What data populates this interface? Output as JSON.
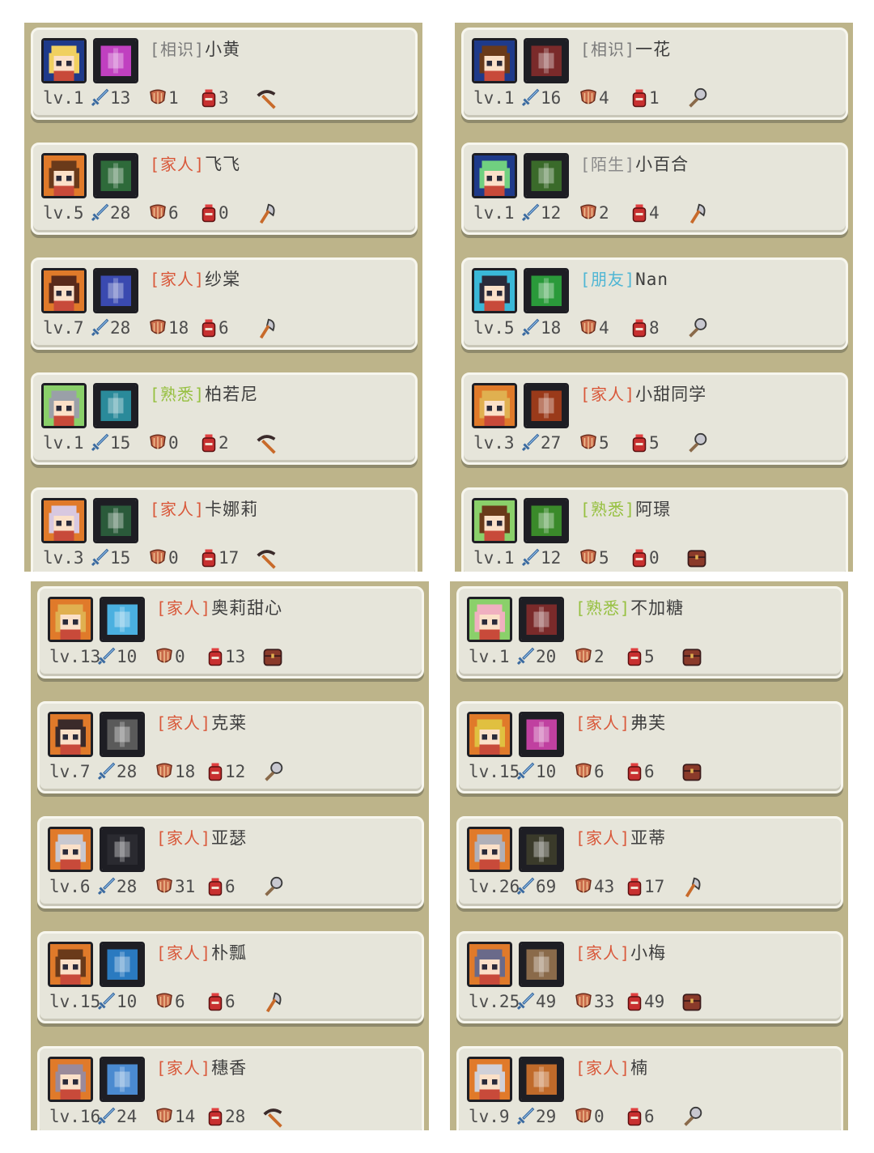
{
  "colors": {
    "panel_bg": "#bdb48a",
    "card_bg": "#e6e5da",
    "relations": {
      "相识": "#7a7a7a",
      "陌生": "#8a8a8a",
      "家人": "#d9583a",
      "熟悉": "#96c040",
      "朋友": "#4fb6d4"
    }
  },
  "panels": [
    {
      "id": "top-left",
      "characters": [
        {
          "relation": "相识",
          "name": "小黄",
          "level": "lv.1",
          "attack": "13",
          "defense": "1",
          "hp": "3",
          "tool": "pickaxe-icon",
          "portrait_bg": "#1e3a8a",
          "hair": "#f0d060",
          "skill_color": "#c040c0"
        },
        {
          "relation": "家人",
          "name": "飞飞",
          "level": "lv.5",
          "attack": "28",
          "defense": "6",
          "hp": "0",
          "tool": "axe-icon",
          "portrait_bg": "#e07a2a",
          "hair": "#6a3a1a",
          "skill_color": "#2e6a3a"
        },
        {
          "relation": "家人",
          "name": "纱棠",
          "level": "lv.7",
          "attack": "28",
          "defense": "18",
          "hp": "6",
          "tool": "axe-icon",
          "portrait_bg": "#e07a2a",
          "hair": "#5a2a1a",
          "skill_color": "#3a4ab0"
        },
        {
          "relation": "熟悉",
          "name": "柏若尼",
          "level": "lv.1",
          "attack": "15",
          "defense": "0",
          "hp": "2",
          "tool": "pickaxe-icon",
          "portrait_bg": "#8ad06a",
          "hair": "#9aa0a8",
          "skill_color": "#2a8a9a"
        },
        {
          "relation": "家人",
          "name": "卡娜莉",
          "level": "lv.3",
          "attack": "15",
          "defense": "0",
          "hp": "17",
          "tool": "pickaxe-icon",
          "portrait_bg": "#e07a2a",
          "hair": "#d8c8e0",
          "skill_color": "#2a5a3a"
        }
      ]
    },
    {
      "id": "top-right",
      "characters": [
        {
          "relation": "相识",
          "name": "一花",
          "level": "lv.1",
          "attack": "16",
          "defense": "4",
          "hp": "1",
          "tool": "shovel-icon",
          "portrait_bg": "#1e3a8a",
          "hair": "#6a3a1a",
          "skill_color": "#7a2a2a"
        },
        {
          "relation": "陌生",
          "name": "小百合",
          "level": "lv.1",
          "attack": "12",
          "defense": "2",
          "hp": "4",
          "tool": "axe-icon",
          "portrait_bg": "#1e3a8a",
          "hair": "#70d080",
          "skill_color": "#3a6a2a"
        },
        {
          "relation": "朋友",
          "name": "Nan",
          "level": "lv.5",
          "attack": "18",
          "defense": "4",
          "hp": "8",
          "tool": "shovel-icon",
          "portrait_bg": "#3ab8d8",
          "hair": "#2a2a3a",
          "skill_color": "#2a9a3a"
        },
        {
          "relation": "家人",
          "name": "小甜同学",
          "level": "lv.3",
          "attack": "27",
          "defense": "5",
          "hp": "5",
          "tool": "shovel-icon",
          "portrait_bg": "#e07a2a",
          "hair": "#e0b050",
          "skill_color": "#9a3a1a"
        },
        {
          "relation": "熟悉",
          "name": "阿璟",
          "level": "lv.1",
          "attack": "12",
          "defense": "5",
          "hp": "0",
          "tool": "chest-icon",
          "portrait_bg": "#8ad06a",
          "hair": "#6a3a1a",
          "skill_color": "#3a8a2a"
        }
      ]
    },
    {
      "id": "bottom-left",
      "characters": [
        {
          "relation": "家人",
          "name": "奥莉甜心",
          "level": "lv.13",
          "attack": "10",
          "defense": "0",
          "hp": "13",
          "tool": "chest-icon",
          "portrait_bg": "#e07a2a",
          "hair": "#e0b050",
          "skill_color": "#4ab0e0"
        },
        {
          "relation": "家人",
          "name": "克莱",
          "level": "lv.7",
          "attack": "28",
          "defense": "18",
          "hp": "12",
          "tool": "shovel-icon",
          "portrait_bg": "#e07a2a",
          "hair": "#3a2a2a",
          "skill_color": "#5a5a5a"
        },
        {
          "relation": "家人",
          "name": "亚瑟",
          "level": "lv.6",
          "attack": "28",
          "defense": "31",
          "hp": "6",
          "tool": "shovel-icon",
          "portrait_bg": "#e07a2a",
          "hair": "#c8c8d0",
          "skill_color": "#2a2a30"
        },
        {
          "relation": "家人",
          "name": "朴瓢",
          "level": "lv.15",
          "attack": "10",
          "defense": "6",
          "hp": "6",
          "tool": "axe-icon",
          "portrait_bg": "#e07a2a",
          "hair": "#6a3a1a",
          "skill_color": "#2a7ac0"
        },
        {
          "relation": "家人",
          "name": "穗香",
          "level": "lv.16",
          "attack": "24",
          "defense": "14",
          "hp": "28",
          "tool": "pickaxe-icon",
          "portrait_bg": "#e07a2a",
          "hair": "#9a8a9a",
          "skill_color": "#4a8ad0"
        }
      ]
    },
    {
      "id": "bottom-right",
      "characters": [
        {
          "relation": "熟悉",
          "name": "不加糖",
          "level": "lv.1",
          "attack": "20",
          "defense": "2",
          "hp": "5",
          "tool": "chest-icon",
          "portrait_bg": "#8ad06a",
          "hair": "#f0b0c0",
          "skill_color": "#7a2a2a"
        },
        {
          "relation": "家人",
          "name": "弗芙",
          "level": "lv.15",
          "attack": "10",
          "defense": "6",
          "hp": "6",
          "tool": "chest-icon",
          "portrait_bg": "#e07a2a",
          "hair": "#e0c040",
          "skill_color": "#c040a0"
        },
        {
          "relation": "家人",
          "name": "亚蒂",
          "level": "lv.26",
          "attack": "69",
          "defense": "43",
          "hp": "17",
          "tool": "axe-icon",
          "portrait_bg": "#e07a2a",
          "hair": "#b0b0b8",
          "skill_color": "#3a3a2a"
        },
        {
          "relation": "家人",
          "name": "小梅",
          "level": "lv.25",
          "attack": "49",
          "defense": "33",
          "hp": "49",
          "tool": "chest-icon",
          "portrait_bg": "#e07a2a",
          "hair": "#6a6a8a",
          "skill_color": "#8a6a4a"
        },
        {
          "relation": "家人",
          "name": "楠",
          "level": "lv.9",
          "attack": "29",
          "defense": "0",
          "hp": "6",
          "tool": "shovel-icon",
          "portrait_bg": "#e07a2a",
          "hair": "#d0d0d8",
          "skill_color": "#c06a2a"
        }
      ]
    }
  ]
}
